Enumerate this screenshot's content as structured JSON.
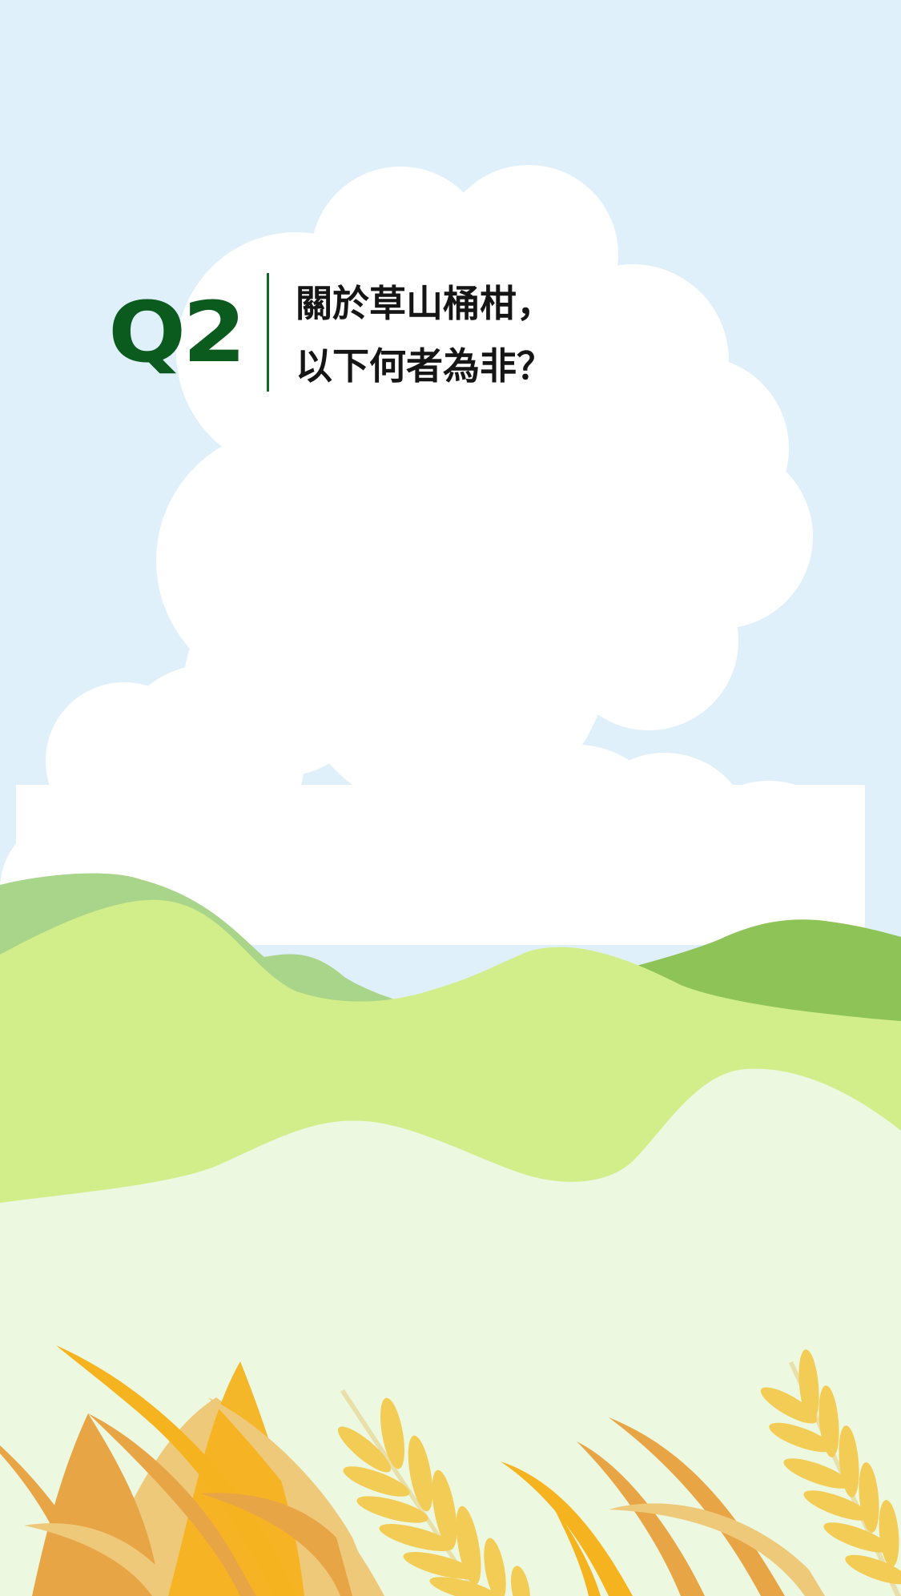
{
  "question": {
    "number": "Q2",
    "line1": "關於草山桶柑，",
    "line2": "以下何者為非？"
  },
  "colors": {
    "sky": "#dff0fa",
    "cloud": "#ffffff",
    "accent_green": "#0b5a1e",
    "hill_light": "#d2ee8a",
    "hill_mid": "#a9d58a",
    "hill_dark": "#8dc357",
    "meadow": "#edf8e0",
    "grain_gold": "#f6b320",
    "grain_orange": "#e8a545",
    "grain_pale": "#efc97a"
  }
}
